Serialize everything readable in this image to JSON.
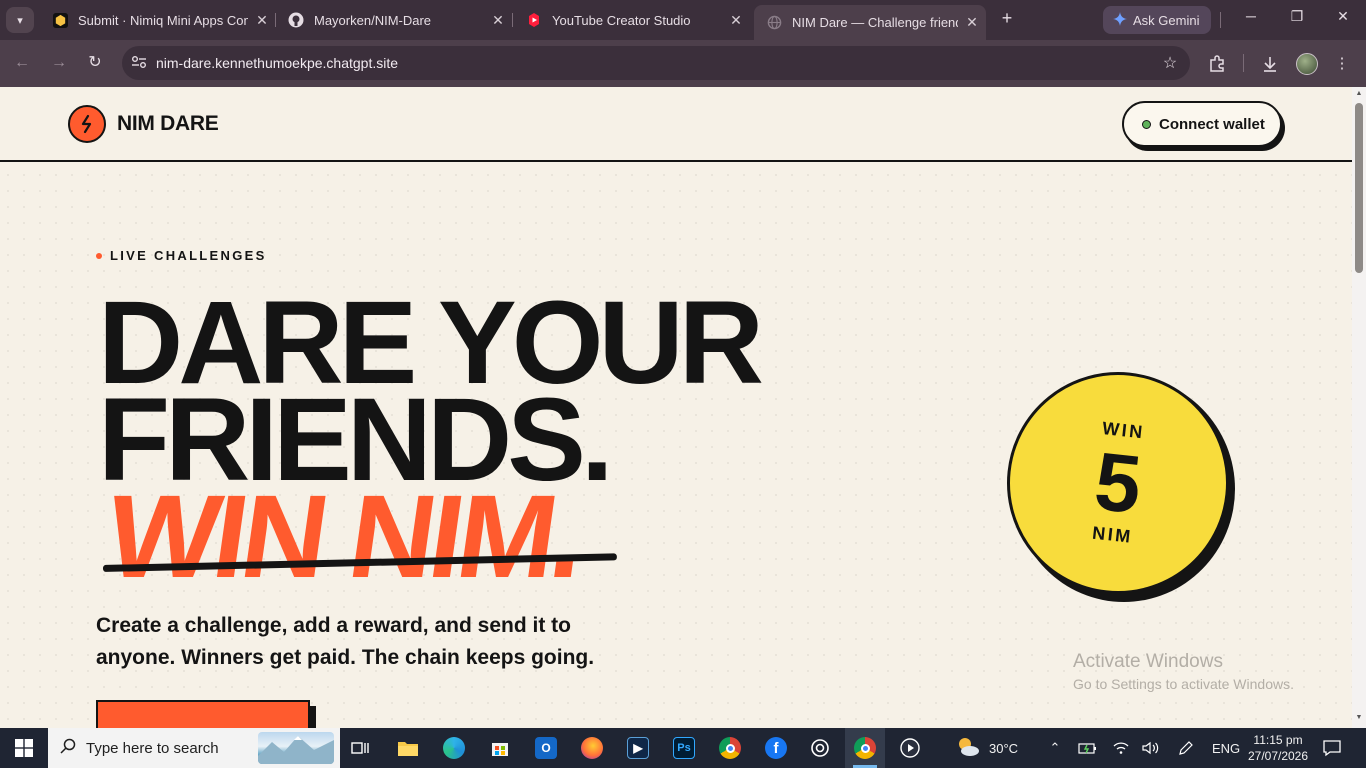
{
  "browser": {
    "tabs": [
      {
        "title": "Submit · Nimiq Mini Apps Comp",
        "favicon": "nimiq-hexagon-icon"
      },
      {
        "title": "Mayorken/NIM-Dare",
        "favicon": "github-icon"
      },
      {
        "title": "YouTube Creator Studio",
        "favicon": "youtube-studio-icon"
      },
      {
        "title": "NIM Dare — Challenge friends.",
        "favicon": "globe-icon",
        "active": true
      }
    ],
    "gemini_label": "Ask Gemini",
    "url": "nim-dare.kennethumoekpe.chatgpt.site"
  },
  "site": {
    "brand": "NIM DARE",
    "connect_wallet": "Connect wallet",
    "eyebrow": "LIVE CHALLENGES",
    "headline_line1": "DARE YOUR",
    "headline_line2": "FRIENDS.",
    "headline_line3": "WIN NIM.",
    "subtitle": "Create a challenge, add a reward, and send it to anyone. Winners get paid. The chain keeps going.",
    "coin": {
      "top": "WIN",
      "amount": "5",
      "bottom": "NIM"
    },
    "colors": {
      "accent": "#ff5b2e",
      "ink": "#141414",
      "paper": "#f6f1e7",
      "coin": "#f8dc3c",
      "wallet_dot": "#5fb25a"
    }
  },
  "watermark": {
    "title": "Activate Windows",
    "subtitle": "Go to Settings to activate Windows."
  },
  "taskbar": {
    "search_placeholder": "Type here to search",
    "weather": "30°C",
    "language": "ENG",
    "time": "11:15 pm",
    "date": "27/07/2026",
    "apps": [
      "task-view-icon",
      "file-explorer-icon",
      "edge-icon",
      "microsoft-store-icon",
      "outlook-icon",
      "firefox-icon",
      "video-editor-icon",
      "photoshop-icon",
      "chrome-icon",
      "facebook-icon",
      "chatgpt-icon",
      "chrome-profile-icon",
      "media-player-icon"
    ]
  }
}
